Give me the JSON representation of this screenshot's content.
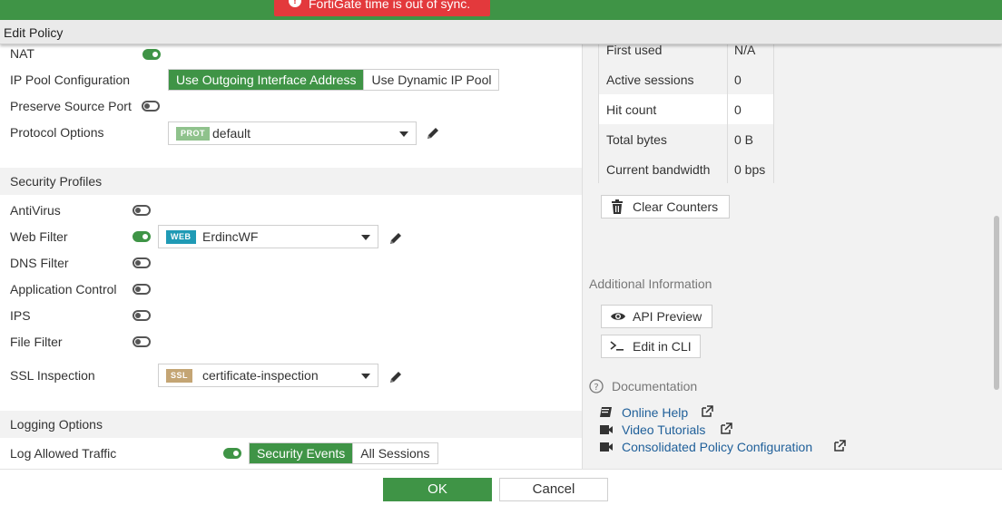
{
  "alert": {
    "text": "FortiGate time is out of sync.",
    "icon": "exclamation-circle-icon",
    "color": "#e3393c"
  },
  "header": {
    "title": "Edit Policy",
    "bar_color": "#3f9446"
  },
  "firewall": {
    "nat_label": "NAT",
    "nat_enabled": true,
    "ip_pool_label": "IP Pool Configuration",
    "ip_pool_options": [
      "Use Outgoing Interface Address",
      "Use Dynamic IP Pool"
    ],
    "ip_pool_selected": "Use Outgoing Interface Address",
    "preserve_port_label": "Preserve Source Port",
    "preserve_port_enabled": false,
    "protocol_label": "Protocol Options",
    "protocol_badge": "PROT",
    "protocol_value": "default"
  },
  "security_profiles": {
    "heading": "Security Profiles",
    "antivirus_label": "AntiVirus",
    "antivirus_enabled": false,
    "webfilter_label": "Web Filter",
    "webfilter_enabled": true,
    "webfilter_badge": "WEB",
    "webfilter_value": "ErdincWF",
    "dnsfilter_label": "DNS Filter",
    "dnsfilter_enabled": false,
    "appcontrol_label": "Application Control",
    "appcontrol_enabled": false,
    "ips_label": "IPS",
    "ips_enabled": false,
    "filefilter_label": "File Filter",
    "filefilter_enabled": false,
    "ssl_label": "SSL Inspection",
    "ssl_badge": "SSL",
    "ssl_value": "certificate-inspection"
  },
  "logging": {
    "heading": "Logging Options",
    "log_allowed_label": "Log Allowed Traffic",
    "log_allowed_enabled": true,
    "log_options": [
      "Security Events",
      "All Sessions"
    ],
    "log_selected": "Security Events"
  },
  "statistics": {
    "rows": [
      {
        "key": "First used",
        "value": "N/A"
      },
      {
        "key": "Active sessions",
        "value": "0"
      },
      {
        "key": "Hit count",
        "value": "0"
      },
      {
        "key": "Total bytes",
        "value": "0 B"
      },
      {
        "key": "Current bandwidth",
        "value": "0 bps"
      }
    ],
    "clear_button": "Clear Counters"
  },
  "additional_info": {
    "heading": "Additional Information",
    "api_preview": "API Preview",
    "edit_cli": "Edit in CLI"
  },
  "documentation": {
    "heading": "Documentation",
    "links": [
      {
        "label": "Online Help",
        "icon": "book-icon"
      },
      {
        "label": "Video Tutorials",
        "icon": "video-camera-icon"
      },
      {
        "label": "Consolidated Policy Configuration",
        "icon": "video-camera-icon"
      }
    ]
  },
  "footer": {
    "ok_label": "OK",
    "cancel_label": "Cancel"
  },
  "colors": {
    "accent_green": "#3f9446",
    "link_blue": "#1f5f99",
    "prot_badge": "#8fc28c",
    "web_badge": "#1f9ab5",
    "ssl_badge": "#c4a574"
  }
}
